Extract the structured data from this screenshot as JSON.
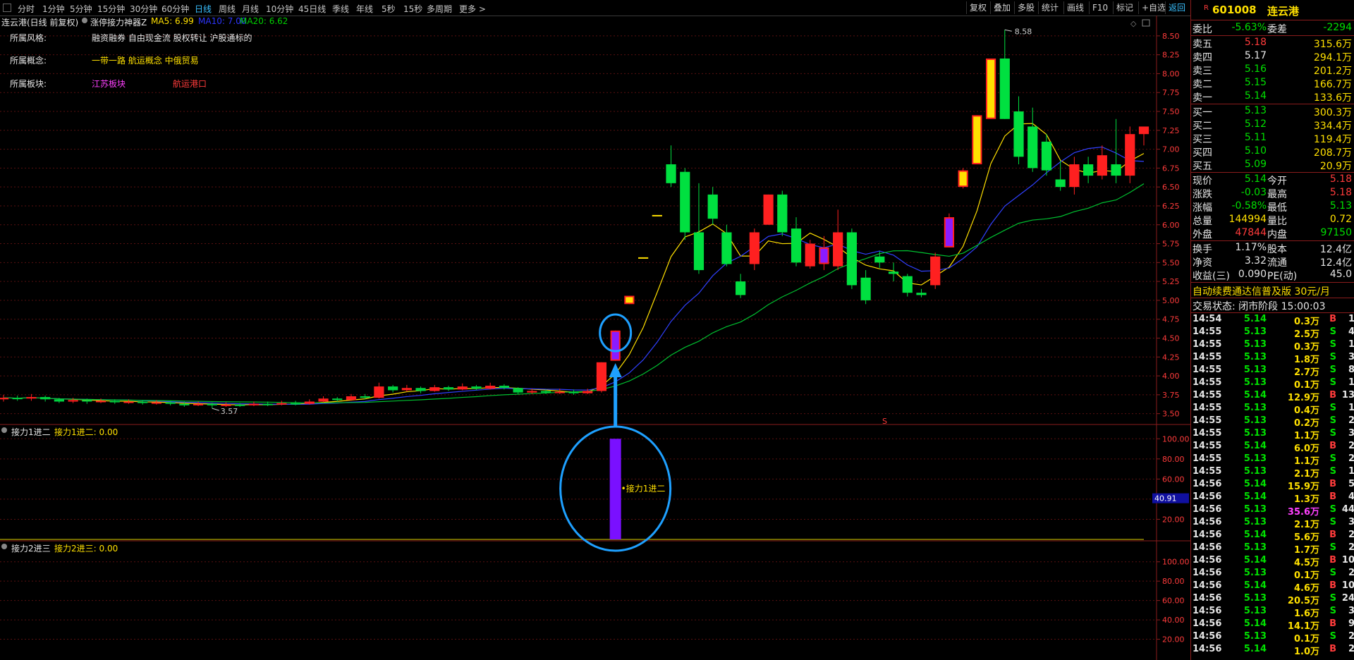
{
  "toolbar": {
    "tabs": [
      "分时",
      "1分钟",
      "5分钟",
      "15分钟",
      "30分钟",
      "60分钟",
      "日线",
      "周线",
      "月线",
      "10分钟",
      "45日线",
      "季线",
      "年线",
      "5秒",
      "15秒",
      "多周期",
      "更多 >"
    ],
    "active_tab": "日线",
    "right_buttons": [
      "复权",
      "叠加",
      "多股",
      "统计",
      "画线",
      "F10",
      "标记",
      "+自选",
      "返回"
    ]
  },
  "main": {
    "header": {
      "stock": "连云港(日线 前复权)",
      "indicator": "涨停接力神器Z",
      "ma5": "MA5: 6.99",
      "ma10": "MA10: 7.00",
      "ma20": "MA20: 6.62"
    },
    "info": {
      "style_label": "所属风格:",
      "style_value": "融资融券 自由现金流 股权转让 沪股通标的",
      "concept_label": "所属概念:",
      "concept_value": "一带一路 航运概念 中俄贸易",
      "sector_label": "所属板块:",
      "sector_value1": "江苏板块",
      "sector_value2": "航运港口"
    },
    "price_axis": [
      "8.50",
      "8.25",
      "8.00",
      "7.75",
      "7.50",
      "7.25",
      "7.00",
      "6.75",
      "6.50",
      "6.25",
      "6.00",
      "5.75",
      "5.50",
      "5.25",
      "5.00",
      "4.75",
      "4.50",
      "4.25",
      "4.00",
      "3.75",
      "3.50"
    ],
    "high_label": "8.58",
    "low_label": "3.57",
    "marker_s": "S"
  },
  "sub1": {
    "title": "接力1进二",
    "value": "接力1进二: 0.00",
    "axis": [
      "100.00",
      "80.00",
      "60.00",
      "40.00",
      "20.00"
    ],
    "cursor_value": "40.91",
    "annotation": "接力1进二"
  },
  "sub2": {
    "title": "接力2进三",
    "value": "接力2进三: 0.00",
    "axis": [
      "100.00",
      "80.00",
      "60.00",
      "40.00",
      "20.00"
    ]
  },
  "chart_data": {
    "type": "candlestick",
    "candles": [
      [
        3.69,
        3.71,
        3.75,
        3.66
      ],
      [
        3.71,
        3.7,
        3.74,
        3.67
      ],
      [
        3.7,
        3.72,
        3.76,
        3.67
      ],
      [
        3.72,
        3.69,
        3.74,
        3.66
      ],
      [
        3.69,
        3.66,
        3.71,
        3.64
      ],
      [
        3.66,
        3.68,
        3.71,
        3.64
      ],
      [
        3.68,
        3.66,
        3.7,
        3.63
      ],
      [
        3.66,
        3.67,
        3.7,
        3.64
      ],
      [
        3.67,
        3.65,
        3.69,
        3.63
      ],
      [
        3.65,
        3.66,
        3.69,
        3.63
      ],
      [
        3.66,
        3.64,
        3.68,
        3.62
      ],
      [
        3.64,
        3.65,
        3.68,
        3.62
      ],
      [
        3.65,
        3.63,
        3.67,
        3.61
      ],
      [
        3.63,
        3.61,
        3.66,
        3.59
      ],
      [
        3.61,
        3.63,
        3.66,
        3.6
      ],
      [
        3.63,
        3.61,
        3.65,
        3.57
      ],
      [
        3.61,
        3.62,
        3.65,
        3.59
      ],
      [
        3.62,
        3.61,
        3.64,
        3.59
      ],
      [
        3.61,
        3.63,
        3.66,
        3.6
      ],
      [
        3.63,
        3.62,
        3.66,
        3.6
      ],
      [
        3.62,
        3.64,
        3.67,
        3.61
      ],
      [
        3.64,
        3.63,
        3.67,
        3.61
      ],
      [
        3.63,
        3.66,
        3.69,
        3.62
      ],
      [
        3.66,
        3.7,
        3.73,
        3.65
      ],
      [
        3.7,
        3.68,
        3.72,
        3.66
      ],
      [
        3.68,
        3.73,
        3.76,
        3.67
      ],
      [
        3.73,
        3.71,
        3.76,
        3.69
      ],
      [
        3.71,
        3.86,
        3.91,
        3.7
      ],
      [
        3.86,
        3.81,
        3.88,
        3.78
      ],
      [
        3.81,
        3.84,
        3.88,
        3.79
      ],
      [
        3.84,
        3.8,
        3.86,
        3.77
      ],
      [
        3.8,
        3.85,
        3.88,
        3.79
      ],
      [
        3.85,
        3.82,
        3.87,
        3.8
      ],
      [
        3.82,
        3.86,
        3.9,
        3.81
      ],
      [
        3.86,
        3.83,
        3.88,
        3.81
      ],
      [
        3.83,
        3.87,
        3.91,
        3.82
      ],
      [
        3.87,
        3.84,
        3.89,
        3.82
      ],
      [
        3.84,
        3.78,
        3.85,
        3.76
      ],
      [
        3.78,
        3.8,
        3.83,
        3.76
      ],
      [
        3.8,
        3.78,
        3.82,
        3.76
      ],
      [
        3.78,
        3.79,
        3.83,
        3.76
      ],
      [
        3.79,
        3.77,
        3.82,
        3.75
      ],
      [
        3.77,
        3.8,
        3.83,
        3.76
      ],
      [
        3.8,
        4.18,
        4.18,
        3.78
      ],
      [
        4.2,
        4.6,
        4.6,
        4.2
      ],
      [
        4.95,
        5.06,
        5.06,
        4.95
      ],
      [
        5.56,
        5.56,
        5.56,
        5.56
      ],
      [
        6.12,
        6.12,
        6.12,
        6.12
      ],
      [
        6.8,
        6.55,
        7.05,
        6.5
      ],
      [
        6.7,
        5.9,
        6.75,
        5.8
      ],
      [
        5.9,
        5.4,
        6.55,
        5.35
      ],
      [
        6.4,
        6.08,
        6.5,
        6.0
      ],
      [
        5.9,
        5.48,
        6.0,
        5.45
      ],
      [
        5.25,
        5.07,
        5.35,
        5.03
      ],
      [
        5.48,
        5.9,
        5.95,
        5.4
      ],
      [
        6.0,
        6.4,
        6.4,
        6.0
      ],
      [
        6.4,
        5.9,
        6.45,
        5.85
      ],
      [
        5.95,
        5.5,
        6.1,
        5.45
      ],
      [
        5.45,
        5.75,
        5.8,
        5.42
      ],
      [
        5.7,
        5.48,
        5.85,
        5.4
      ],
      [
        5.45,
        5.9,
        6.2,
        5.4
      ],
      [
        5.9,
        5.2,
        5.95,
        5.15
      ],
      [
        5.3,
        5.0,
        5.4,
        4.95
      ],
      [
        5.58,
        5.5,
        5.65,
        5.43
      ],
      [
        5.38,
        5.35,
        5.5,
        5.25
      ],
      [
        5.32,
        5.1,
        5.35,
        5.05
      ],
      [
        5.1,
        5.07,
        5.15,
        5.04
      ],
      [
        5.2,
        5.58,
        5.63,
        5.15
      ],
      [
        5.7,
        6.1,
        6.15,
        5.7
      ],
      [
        6.5,
        6.72,
        6.75,
        6.48
      ],
      [
        6.8,
        7.45,
        7.45,
        6.8
      ],
      [
        7.4,
        8.2,
        8.2,
        7.4
      ],
      [
        8.2,
        7.4,
        8.58,
        7.4
      ],
      [
        7.5,
        6.9,
        7.7,
        6.8
      ],
      [
        7.3,
        6.75,
        7.55,
        6.7
      ],
      [
        7.1,
        6.72,
        7.2,
        6.65
      ],
      [
        6.6,
        6.5,
        6.85,
        6.45
      ],
      [
        6.5,
        6.8,
        6.9,
        6.4
      ],
      [
        6.8,
        6.65,
        6.9,
        6.55
      ],
      [
        6.65,
        6.92,
        7.05,
        6.6
      ],
      [
        6.8,
        6.65,
        7.4,
        6.55
      ],
      [
        6.65,
        7.2,
        7.3,
        6.55
      ],
      [
        7.2,
        7.3,
        7.3,
        7.05
      ]
    ],
    "special": {
      "purple_up": [
        44,
        59,
        68
      ],
      "yellow_up": [
        45,
        69,
        70,
        71
      ],
      "flat": [
        46,
        47
      ]
    },
    "sub1_bar": {
      "index": 44,
      "value": 100.0
    },
    "ylim": [
      3.45,
      8.62
    ]
  }
}
